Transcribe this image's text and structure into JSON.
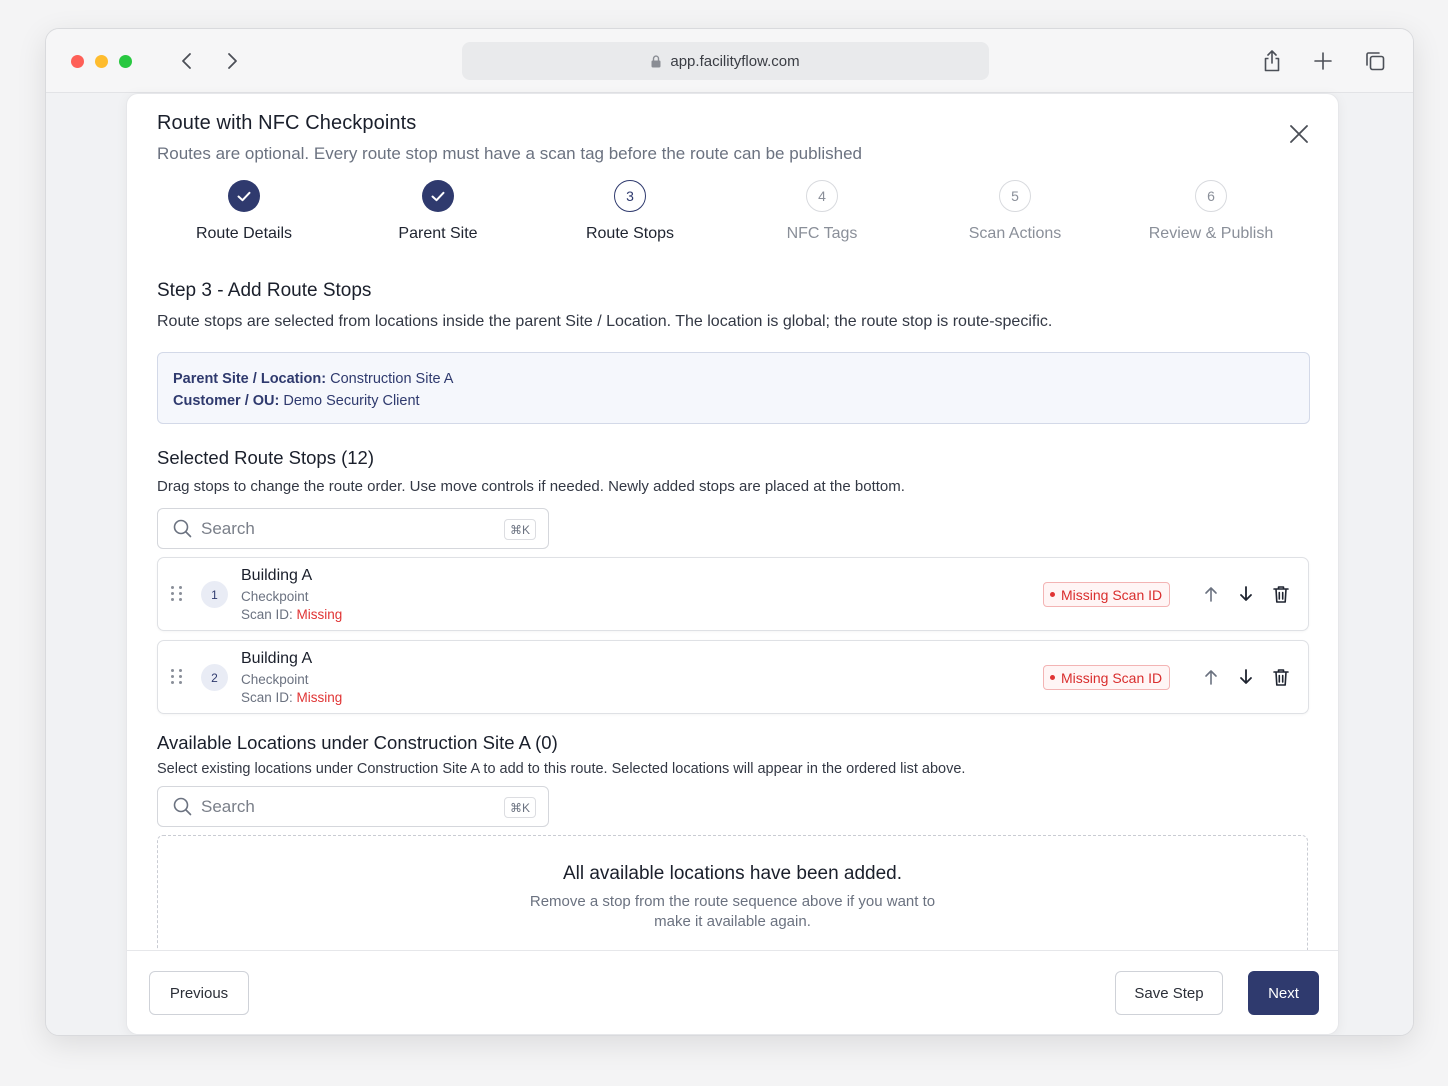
{
  "browser": {
    "url": "app.facilityflow.com"
  },
  "modal": {
    "title": "Route with NFC Checkpoints",
    "subtitle": "Routes are optional. Every route stop must have a scan tag before the route can be published"
  },
  "stepper": {
    "steps": [
      {
        "number": "1",
        "label": "Route Details",
        "state": "done"
      },
      {
        "number": "2",
        "label": "Parent Site",
        "state": "done"
      },
      {
        "number": "3",
        "label": "Route Stops",
        "state": "current"
      },
      {
        "number": "4",
        "label": "NFC Tags",
        "state": "todo"
      },
      {
        "number": "5",
        "label": "Scan Actions",
        "state": "todo"
      },
      {
        "number": "6",
        "label": "Review & Publish",
        "state": "todo"
      }
    ]
  },
  "step_section": {
    "title": "Step 3 - Add Route Stops",
    "description": "Route stops are selected from locations inside the parent Site / Location. The location is global; the route stop is route-specific."
  },
  "info": {
    "parent_label": "Parent Site / Location:",
    "parent_value": " Construction Site A",
    "customer_label": "Customer / OU:",
    "customer_value": " Demo Security Client"
  },
  "selected": {
    "title": "Selected Route Stops (12)",
    "description": "Drag stops to change the route order. Use move controls if needed. Newly added stops are placed at the bottom.",
    "search_placeholder": "Search",
    "search_shortcut": "⌘K",
    "stops": [
      {
        "index": "1",
        "name": "Building A",
        "type": "Checkpoint",
        "scan_label": "Scan ID: ",
        "scan_value": "Missing",
        "badge": "Missing Scan ID"
      },
      {
        "index": "2",
        "name": "Building A",
        "type": "Checkpoint",
        "scan_label": "Scan ID: ",
        "scan_value": "Missing",
        "badge": "Missing Scan ID"
      }
    ]
  },
  "available": {
    "title": "Available Locations under Construction Site A (0)",
    "description": "Select existing locations under Construction Site A to add to this route. Selected locations will appear in the ordered list above.",
    "search_placeholder": "Search",
    "search_shortcut": "⌘K",
    "empty_title": "All available locations have been added.",
    "empty_desc": "Remove a stop from the route sequence above if you want to make it available again."
  },
  "footer": {
    "previous_label": "Previous",
    "save_label": "Save Step",
    "next_label": "Next"
  },
  "colors": {
    "primary": "#2f3a6e",
    "error": "#e03434"
  }
}
